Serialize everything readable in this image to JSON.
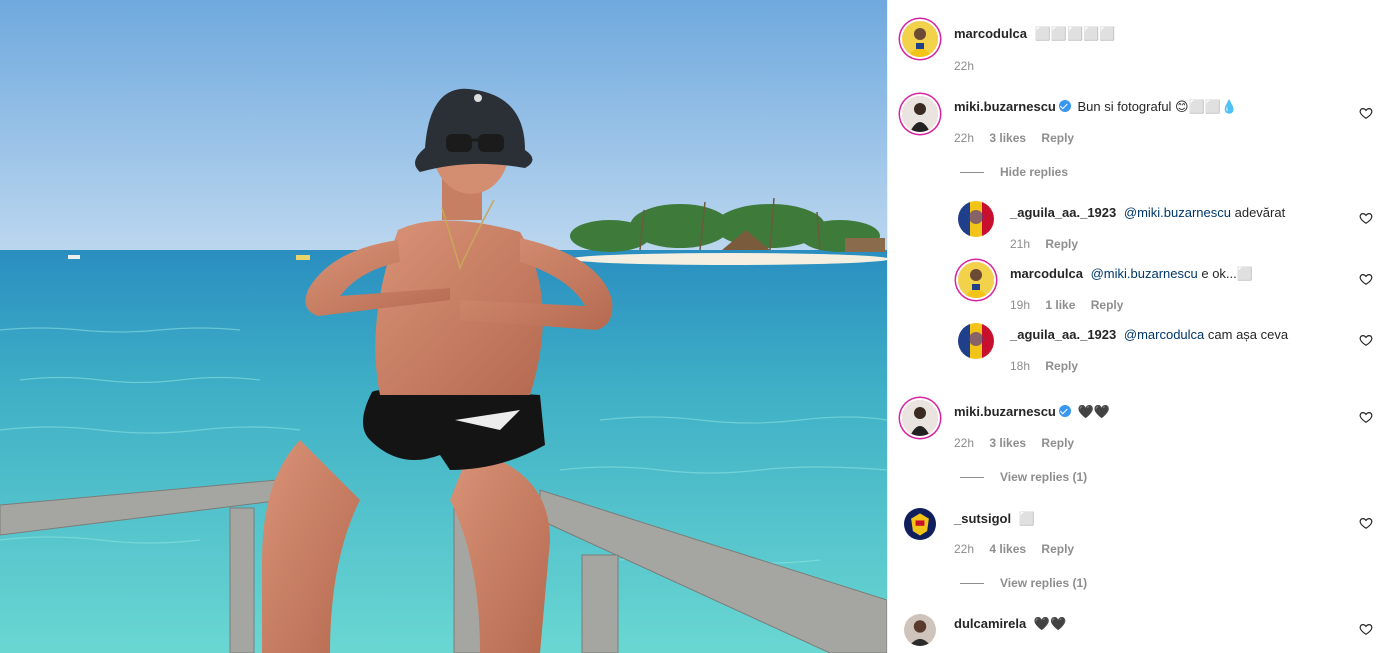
{
  "photo": {
    "alt": ""
  },
  "caption": {
    "username": "marcodulca",
    "text": "⬜⬜⬜⬜⬜",
    "time": "22h"
  },
  "comments": [
    {
      "username": "miki.buzarnescu",
      "verified": true,
      "text": "Bun si fotograful 😊⬜⬜💧",
      "time": "22h",
      "likes": "3 likes",
      "reply": "Reply",
      "toggle": "Hide replies",
      "replies": [
        {
          "username": "_aguila_aa._1923",
          "mention": "@miki.buzarnescu",
          "text": " adevărat",
          "time": "21h",
          "likes": "",
          "reply": "Reply"
        },
        {
          "username": "marcodulca",
          "mention": "@miki.buzarnescu",
          "text": " e ok...⬜",
          "time": "19h",
          "likes": "1 like",
          "reply": "Reply"
        },
        {
          "username": "_aguila_aa._1923",
          "mention": "@marcodulca",
          "text": " cam așa ceva",
          "time": "18h",
          "likes": "",
          "reply": "Reply"
        }
      ]
    },
    {
      "username": "miki.buzarnescu",
      "verified": true,
      "text": "🖤🖤",
      "time": "22h",
      "likes": "3 likes",
      "reply": "Reply",
      "toggle": "View replies (1)"
    },
    {
      "username": "_sutsigol",
      "verified": false,
      "text": "⬜",
      "time": "22h",
      "likes": "4 likes",
      "reply": "Reply",
      "toggle": "View replies (1)"
    },
    {
      "username": "dulcamirela",
      "verified": false,
      "text": "🖤🖤"
    }
  ],
  "icons": {
    "like": "heart-outline-icon",
    "verified": "verified-badge-icon"
  },
  "colors": {
    "verified": "#3897f0",
    "mention": "#00376b",
    "meta": "#8e8e8e",
    "story_ring": "#d6249f"
  }
}
